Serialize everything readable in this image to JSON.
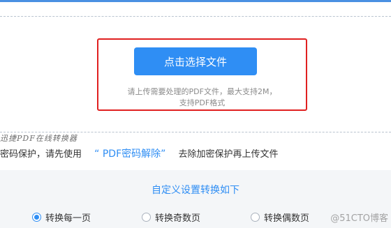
{
  "upload": {
    "button_label": "点击选择文件",
    "hint_line1": "请上传需要处理的PDF文件，最大支持2M，",
    "hint_line2": "支持PDF格式"
  },
  "handwritten_caption": "迅捷PDF在线转换器",
  "notice": {
    "before": "密码保护，请先使用",
    "link": "“ PDF密码解除”",
    "after": "去除加密保护再上传文件"
  },
  "settings": {
    "title": "自定义设置转换如下",
    "options": [
      {
        "label": "转换每一页",
        "checked": true
      },
      {
        "label": "转换奇数页",
        "checked": false
      },
      {
        "label": "转换偶数页",
        "checked": false
      }
    ]
  },
  "watermark": "@51CTO博客",
  "colors": {
    "accent": "#2f8ef4",
    "highlight_border": "#e02020",
    "panel_bg": "#f4f6f8"
  }
}
